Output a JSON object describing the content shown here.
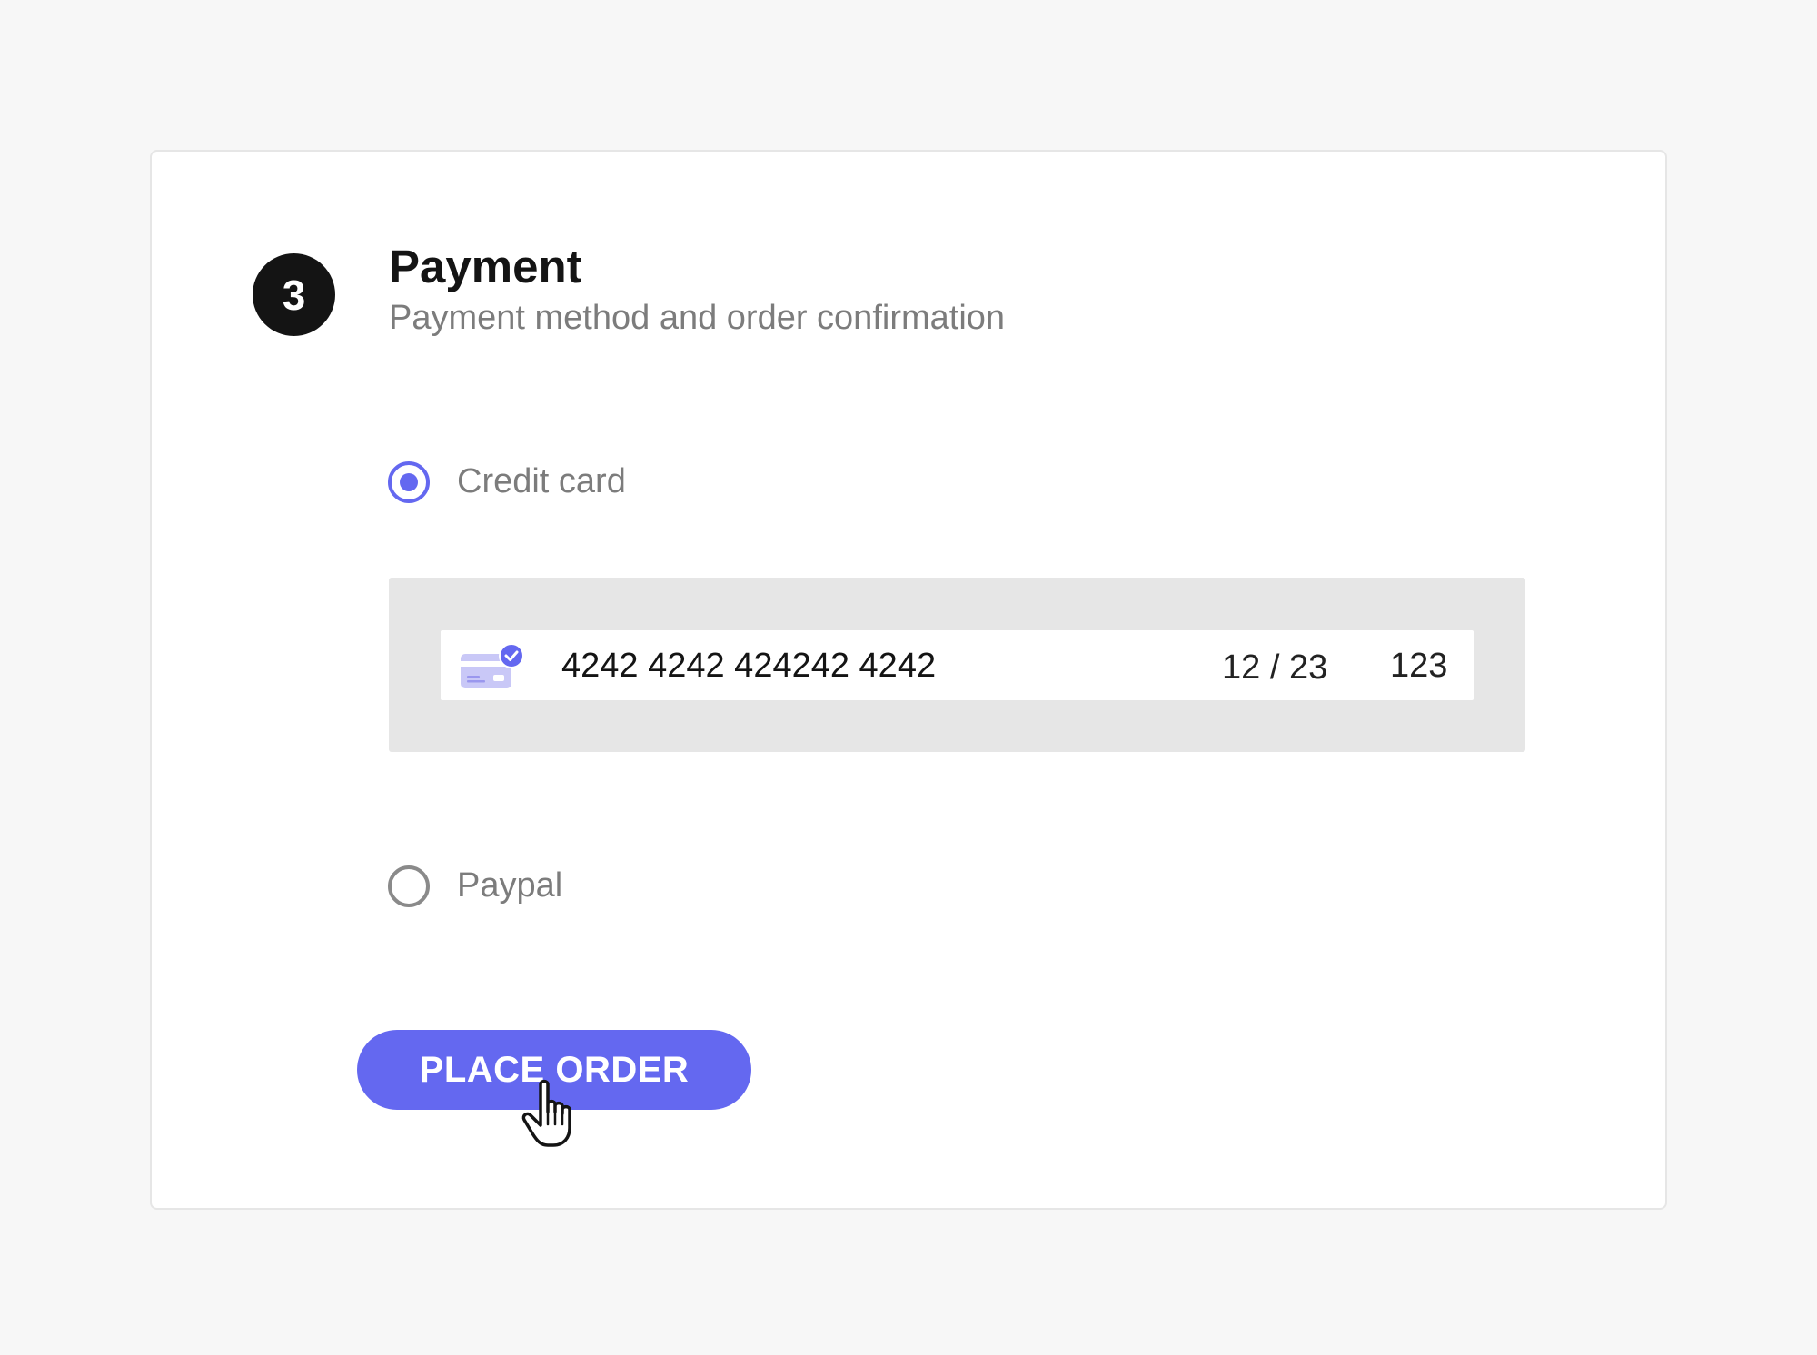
{
  "step": {
    "number": "3",
    "title": "Payment",
    "subtitle": "Payment method and order confirmation"
  },
  "payment_options": [
    {
      "label": "Credit card",
      "selected": true
    },
    {
      "label": "Paypal",
      "selected": false
    }
  ],
  "card_form": {
    "number": "4242 4242 424242 4242",
    "expiry": "12 / 23",
    "cvc": "123",
    "icon": "credit-card-check-icon"
  },
  "actions": {
    "place_order_label": "PLACE ORDER"
  },
  "colors": {
    "accent": "#6468f0",
    "badge": "#141414",
    "panel": "#e6e6e6"
  },
  "cursor": "hand-pointer-icon"
}
